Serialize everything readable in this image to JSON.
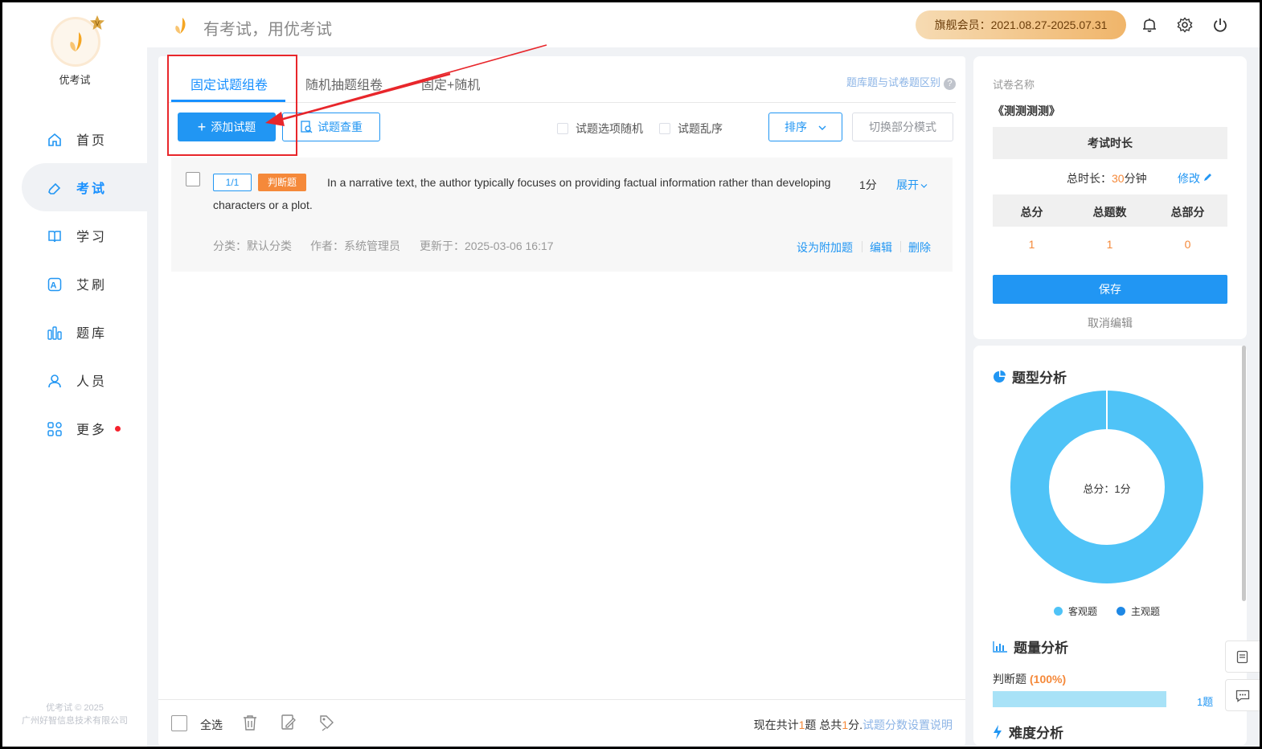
{
  "sidebar": {
    "brand": "优考试",
    "nav": [
      {
        "label": "首页",
        "icon": "home-icon"
      },
      {
        "label": "考试",
        "icon": "eraser-icon",
        "active": true
      },
      {
        "label": "学习",
        "icon": "book-icon"
      },
      {
        "label": "艾刷",
        "icon": "letter-a-icon"
      },
      {
        "label": "题库",
        "icon": "chart-bars-icon"
      },
      {
        "label": "人员",
        "icon": "user-icon"
      },
      {
        "label": "更多",
        "icon": "apps-icon",
        "has_dot": true
      }
    ],
    "copyright_line1": "优考试 © 2025",
    "copyright_line2": "广州好智信息技术有限公司"
  },
  "header": {
    "slogan": "有考试，用优考试",
    "membership": "旗舰会员：2021.08.27-2025.07.31",
    "icons": [
      "bell-icon",
      "gear-icon",
      "power-icon"
    ]
  },
  "tabs": {
    "items": [
      "固定试题组卷",
      "随机抽题组卷",
      "固定+随机"
    ],
    "active_index": 0,
    "help_link": "题库题与试卷题区别",
    "help_icon": "?"
  },
  "toolbar": {
    "add_question": "添加试题",
    "check_duplicate": "试题查重",
    "option_random": "试题选项随机",
    "question_shuffle": "试题乱序",
    "sort": "排序",
    "switch_mode": "切换部分模式"
  },
  "question": {
    "index": "1/1",
    "type": "判断题",
    "text": "In a narrative text, the author typically focuses on providing factual information rather than developing characters or a plot.",
    "score": "1分",
    "expand": "展开",
    "category": "分类：默认分类",
    "author": "作者：系统管理员",
    "updated": "更新于：2025-03-06 16:17",
    "actions": [
      "设为附加题",
      "编辑",
      "删除"
    ]
  },
  "footer": {
    "select_all": "全选",
    "summary_prefix": "现在共计",
    "question_count": "1",
    "summary_mid": "题 总共",
    "total_score": "1",
    "summary_suffix": "分.",
    "score_help_link": "试题分数设置说明"
  },
  "paper_panel": {
    "name_label": "试卷名称",
    "name": "《测测测测》",
    "duration_header": "考试时长",
    "duration_label": "总时长：",
    "duration_value": "30",
    "duration_unit": "分钟",
    "edit": "修改",
    "stats": [
      {
        "label": "总分",
        "value": "1"
      },
      {
        "label": "总题数",
        "value": "1"
      },
      {
        "label": "总部分",
        "value": "0"
      }
    ],
    "save": "保存",
    "cancel_edit": "取消编辑"
  },
  "analysis_panel": {
    "type_title": "题型分析",
    "donut_center": "总分：1分",
    "legend": [
      {
        "name": "客观题",
        "color": "#4fc3f7"
      },
      {
        "name": "主观题",
        "color": "#1e88e5"
      }
    ],
    "objective_fraction": 1.0,
    "count_title": "题量分析",
    "judge_label": "判断题",
    "judge_pct": "(100%)",
    "judge_count": "1题",
    "difficulty_title": "难度分析"
  },
  "colors": {
    "primary": "#2196f3",
    "accent_orange": "#f5893a",
    "annotation_red": "#e8262b",
    "donut_blue": "#4fc3f7"
  }
}
